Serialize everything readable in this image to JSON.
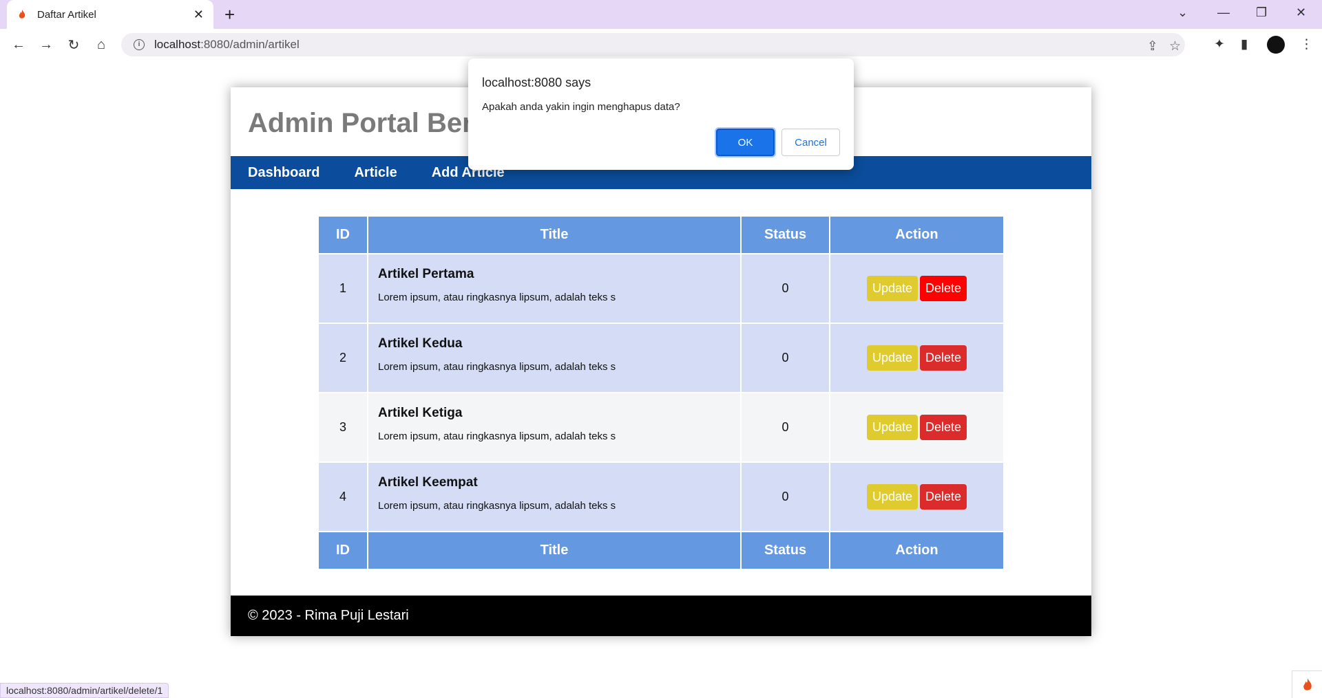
{
  "browser": {
    "tab_title": "Daftar Artikel",
    "url_host": "localhost",
    "url_rest": ":8080/admin/artikel",
    "status_url": "localhost:8080/admin/artikel/delete/1"
  },
  "site": {
    "title": "Admin Portal Berita",
    "nav": [
      "Dashboard",
      "Article",
      "Add Article"
    ],
    "footer": "© 2023 - Rima Puji Lestari"
  },
  "table": {
    "headers": [
      "ID",
      "Title",
      "Status",
      "Action"
    ],
    "rows": [
      {
        "id": "1",
        "title": "Artikel Pertama",
        "desc": "Lorem ipsum, atau ringkasnya lipsum, adalah teks s",
        "status": "0"
      },
      {
        "id": "2",
        "title": "Artikel Kedua",
        "desc": "Lorem ipsum, atau ringkasnya lipsum, adalah teks s",
        "status": "0"
      },
      {
        "id": "3",
        "title": "Artikel Ketiga",
        "desc": "Lorem ipsum, atau ringkasnya lipsum, adalah teks s",
        "status": "0"
      },
      {
        "id": "4",
        "title": "Artikel Keempat",
        "desc": "Lorem ipsum, atau ringkasnya lipsum, adalah teks s",
        "status": "0"
      }
    ],
    "update_label": "Update",
    "delete_label": "Delete"
  },
  "dialog": {
    "title": "localhost:8080 says",
    "message": "Apakah anda yakin ingin menghapus data?",
    "ok": "OK",
    "cancel": "Cancel"
  },
  "colors": {
    "nav": "#0b4d9c",
    "table_header": "#6499e2",
    "update": "#e0cb2f",
    "delete": "#dc2b2b"
  }
}
